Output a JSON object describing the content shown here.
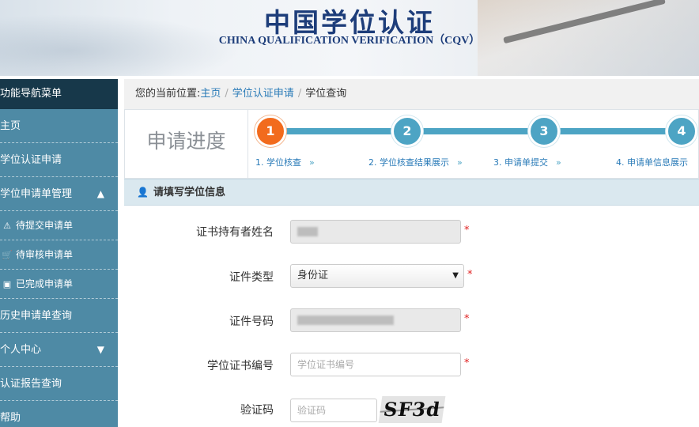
{
  "header": {
    "title": "中国学位认证",
    "subtitle": "CHINA QUALIFICATION VERIFICATION（CQV）"
  },
  "sidebar": {
    "heading": "功能导航菜单",
    "items": [
      {
        "label": "主页"
      },
      {
        "label": "学位认证申请"
      },
      {
        "label": "学位申请单管理",
        "chevron": "up"
      },
      {
        "label": "待提交申请单",
        "icon": "warning-icon"
      },
      {
        "label": "待审核申请单",
        "icon": "cart-icon"
      },
      {
        "label": "已完成申请单",
        "icon": "briefcase-icon"
      },
      {
        "label": "历史申请单查询"
      },
      {
        "label": "个人中心",
        "chevron": "down"
      },
      {
        "label": "认证报告查询"
      },
      {
        "label": "帮助"
      }
    ]
  },
  "breadcrumb": {
    "prefix": "您的当前位置:",
    "home": "主页",
    "level1": "学位认证申请",
    "current": "学位查询",
    "separator": "/"
  },
  "progress": {
    "title": "申请进度",
    "active_step": 1,
    "steps": [
      {
        "number": "1",
        "label": "1. 学位核查"
      },
      {
        "number": "2",
        "label": "2. 学位核查结果展示"
      },
      {
        "number": "3",
        "label": "3. 申请单提交"
      },
      {
        "number": "4",
        "label": "4. 申请单信息展示"
      }
    ],
    "arrow": "»"
  },
  "section": {
    "title": "请填写学位信息"
  },
  "form": {
    "fields": [
      {
        "label": "证书持有者姓名",
        "value": "",
        "required": "*"
      },
      {
        "label": "证件类型",
        "value": "身份证",
        "required": "*"
      },
      {
        "label": "证件号码",
        "value": "",
        "required": "*"
      },
      {
        "label": "学位证书编号",
        "placeholder": "学位证书编号",
        "required": "*"
      },
      {
        "label": "验证码",
        "placeholder": "验证码",
        "captcha": "SF3d"
      }
    ]
  },
  "colors": {
    "brand": "#1d3d7a",
    "sidebar": "#4e8aa5",
    "sidebar_head": "#17384a",
    "step": "#4da4c4",
    "step_active": "#f26b1d",
    "link": "#2a7bb8",
    "required": "#e02020"
  }
}
